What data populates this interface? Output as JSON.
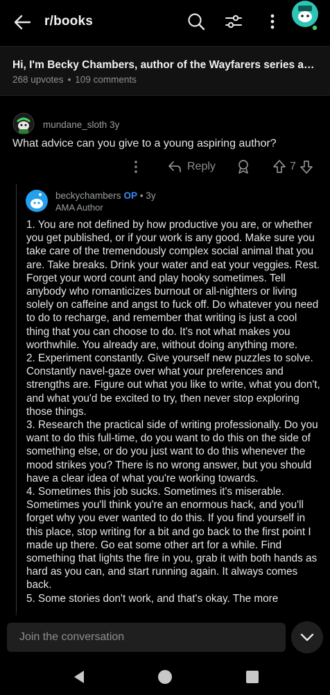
{
  "topbar": {
    "subreddit": "r/books",
    "icons": [
      "back-arrow-icon",
      "search-icon",
      "filter-sliders-icon",
      "more-vertical-icon",
      "snoo-avatar-icon"
    ]
  },
  "post": {
    "title": "Hi, I'm Becky Chambers, author of the Wayfarers series and ...",
    "upvotes": "268 upvotes",
    "separator": "•",
    "comments": "109 comments"
  },
  "comment1": {
    "username": "mundane_sloth",
    "age": "3y",
    "body": "What advice can you give to a young aspiring author?",
    "reply_label": "Reply",
    "score": "7"
  },
  "comment2": {
    "username": "beckychambers",
    "op_badge": "OP",
    "meta": "• 3y",
    "flair": "AMA Author",
    "paragraphs": [
      "1. You are not defined by how productive you are, or whether you get published, or if your work is any good. Make sure you take care of the tremendously complex social animal that you are. Take breaks. Drink your water and eat your veggies. Rest. Forget your word count and play hooky sometimes. Tell anybody who romanticizes burnout or all-nighters or living solely on caffeine and angst to fuck off. Do whatever you need to do to recharge, and remember that writing is just a cool thing that you can choose to do. It's not what makes you worthwhile. You already are, without doing anything more.",
      "2. Experiment constantly. Give yourself new puzzles to solve. Constantly navel-gaze over what your preferences and strengths are. Figure out what you like to write, what you don't, and what you'd be excited to try, then never stop exploring those things.",
      "3. Research the practical side of writing professionally. Do you want to do this full-time, do you want to do this on the side of something else, or do you just want to do this whenever the mood strikes you? There is no wrong answer, but you should have a clear idea of what you're working towards.",
      "4. Sometimes this job sucks. Sometimes it's miserable. Sometimes you'll think you're an enormous hack, and you'll forget why you ever wanted to do this. If you find yourself in this place, stop writing for a bit and go back to the first point I made up there. Go eat some other art for a while. Find something that lights the fire in you, grab it with both hands as hard as you can, and start running again. It always comes back.",
      "5. Some stories don't work, and that's okay. The more"
    ]
  },
  "bottom": {
    "join_placeholder": "Join the conversation"
  },
  "colors": {
    "background": "#000000",
    "header_bg": "#121212",
    "op_blue": "#3a8cf0",
    "muted_text": "#8b8f92",
    "avatar_teal": "#2ec4b6"
  }
}
